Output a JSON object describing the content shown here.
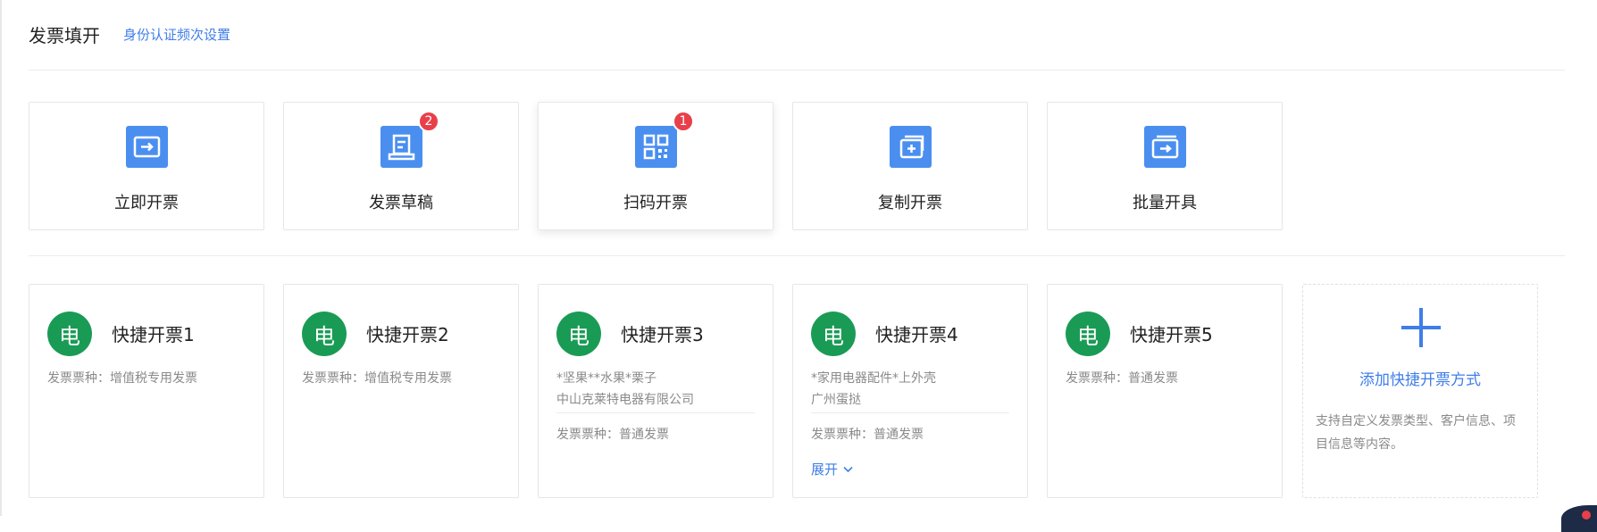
{
  "header": {
    "title": "发票填开",
    "link": "身份认证频次设置"
  },
  "actions": [
    {
      "label": "立即开票",
      "icon": "invoice-arrow-icon"
    },
    {
      "label": "发票草稿",
      "icon": "draft-icon",
      "badge": "2"
    },
    {
      "label": "扫码开票",
      "icon": "qr-code-icon",
      "badge": "1"
    },
    {
      "label": "复制开票",
      "icon": "copy-invoice-icon"
    },
    {
      "label": "批量开具",
      "icon": "batch-invoice-icon"
    }
  ],
  "quick": [
    {
      "avatar": "电",
      "title": "快捷开票1",
      "type": "发票票种：增值税专用发票"
    },
    {
      "avatar": "电",
      "title": "快捷开票2",
      "type": "发票票种：增值税专用发票"
    },
    {
      "avatar": "电",
      "title": "快捷开票3",
      "item": "*坚果**水果*栗子",
      "company": "中山克莱特电器有限公司",
      "type": "发票票种：普通发票"
    },
    {
      "avatar": "电",
      "title": "快捷开票4",
      "item": "*家用电器配件*上外壳",
      "company": "广州蛋挞",
      "type": "发票票种：普通发票",
      "expand": "展开"
    },
    {
      "avatar": "电",
      "title": "快捷开票5",
      "type": "发票票种：普通发票"
    }
  ],
  "add": {
    "label": "添加快捷开票方式",
    "desc": "支持自定义发票类型、客户信息、项目信息等内容。"
  },
  "colors": {
    "accent": "#3f7ee8",
    "icon_bg": "#4a8ff0",
    "avatar_bg": "#1a9b55",
    "badge": "#e8404a"
  }
}
